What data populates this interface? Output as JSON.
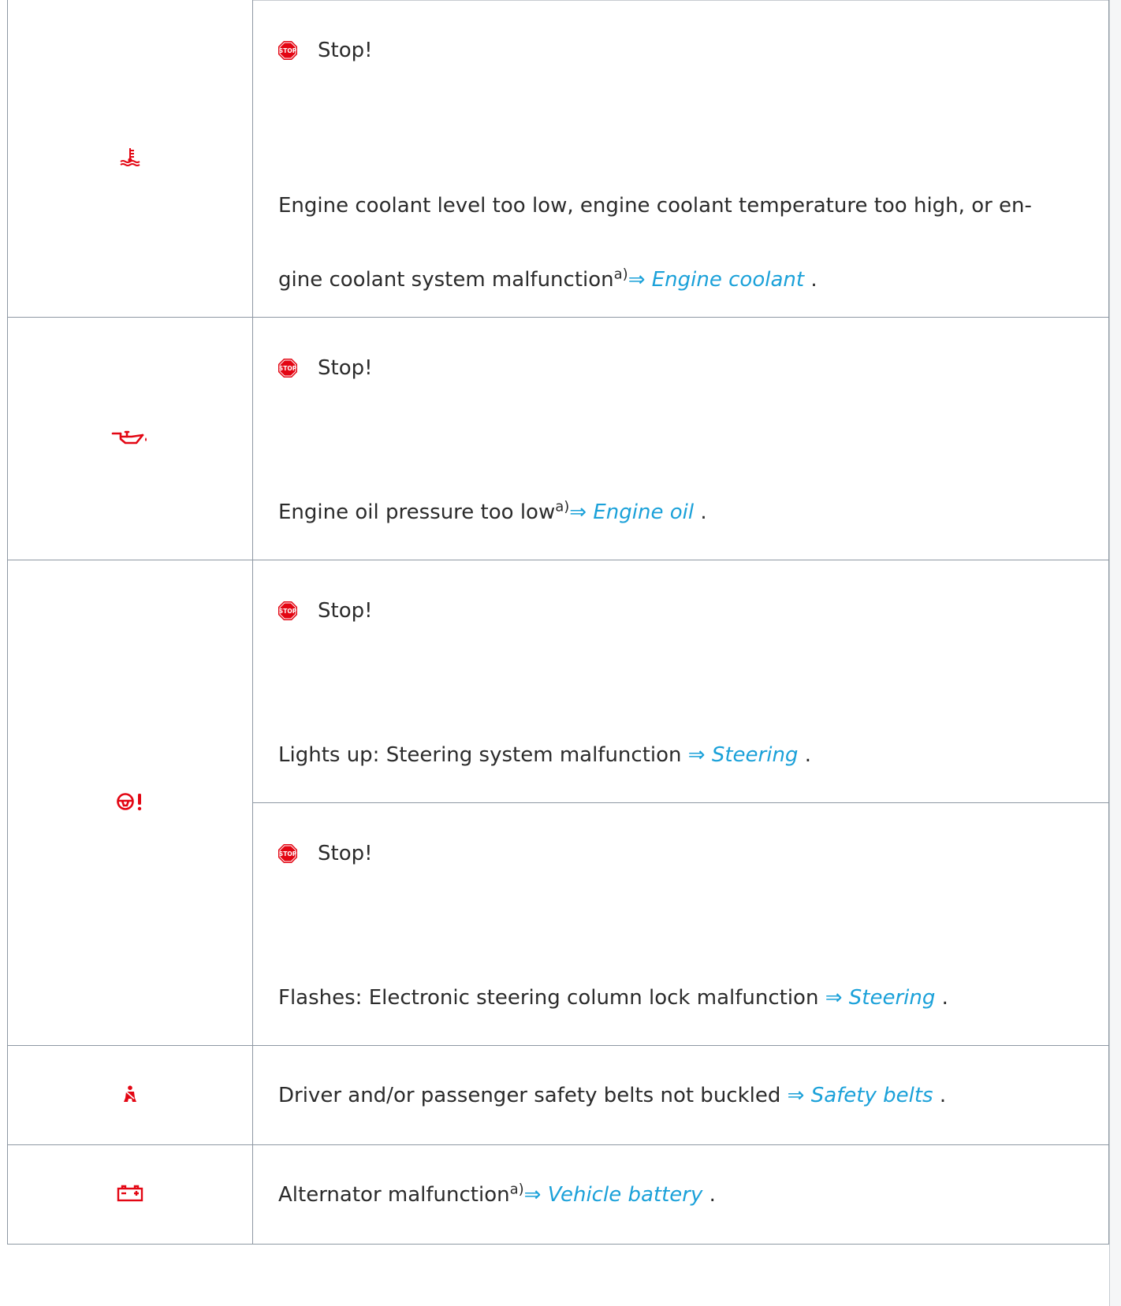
{
  "colors": {
    "warning_red": "#e30613",
    "link_blue": "#1ba1d9",
    "border": "#8e98a3",
    "text": "#2b2b2b"
  },
  "rows": [
    {
      "icon": "coolant-temperature-icon",
      "entries": [
        {
          "stop_label": "Stop!",
          "text_line1": "Engine coolant level too low, engine coolant temperature too high, or en-",
          "text_line2": "gine coolant system malfunction",
          "sup": "a)",
          "arrow": "⇒",
          "link": "Engine coolant",
          "end": "."
        }
      ]
    },
    {
      "icon": "oil-pressure-icon",
      "entries": [
        {
          "stop_label": "Stop!",
          "text": "Engine oil pressure too low",
          "sup": "a)",
          "arrow": "⇒",
          "link": "Engine oil",
          "end": "."
        }
      ]
    },
    {
      "icon": "steering-wheel-warning-icon",
      "entries": [
        {
          "stop_label": "Stop!",
          "text": "Lights up: Steering system malfunction ",
          "arrow": "⇒",
          "link": "Steering",
          "end": "."
        },
        {
          "stop_label": "Stop!",
          "text": "Flashes: Electronic steering column lock malfunction ",
          "arrow": "⇒",
          "link": "Steering",
          "end": "."
        }
      ]
    },
    {
      "icon": "seat-belt-icon",
      "entries": [
        {
          "text": "Driver and/or passenger safety belts not buckled ",
          "arrow": "⇒",
          "link": "Safety belts",
          "end": "."
        }
      ]
    },
    {
      "icon": "battery-icon",
      "entries": [
        {
          "text": "Alternator malfunction",
          "sup": "a)",
          "arrow": "⇒",
          "link": "Vehicle battery",
          "end": "."
        }
      ]
    }
  ]
}
